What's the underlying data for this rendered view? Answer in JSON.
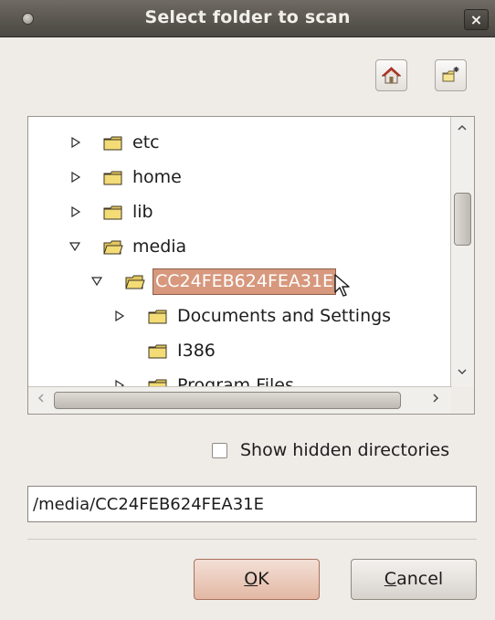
{
  "window": {
    "title": "Select folder to scan",
    "close_glyph": "×"
  },
  "toolbar": {
    "home_icon": "home-icon",
    "new_folder_icon": "new-folder-icon"
  },
  "tree": {
    "items": [
      {
        "label": "etc",
        "level": 0,
        "expanded": false
      },
      {
        "label": "home",
        "level": 0,
        "expanded": false
      },
      {
        "label": "lib",
        "level": 0,
        "expanded": false
      },
      {
        "label": "media",
        "level": 0,
        "expanded": true
      },
      {
        "label": "CC24FEB624FEA31E",
        "level": 1,
        "expanded": true,
        "selected": true
      },
      {
        "label": "Documents and Settings",
        "level": 2,
        "expanded": false
      },
      {
        "label": "I386",
        "level": 2,
        "expanded": null
      },
      {
        "label": "Program Files",
        "level": 2,
        "expanded": false
      }
    ]
  },
  "options": {
    "show_hidden_label": "Show hidden directories",
    "show_hidden_checked": false
  },
  "path_field": {
    "value": "/media/CC24FEB624FEA31E"
  },
  "buttons": {
    "ok_mnemonic": "O",
    "ok_rest": "K",
    "cancel_mnemonic": "C",
    "cancel_rest": "ancel"
  },
  "colors": {
    "selection": "#d7987d",
    "default_button": "#e3b8a4",
    "folder": "#f3dc76"
  }
}
